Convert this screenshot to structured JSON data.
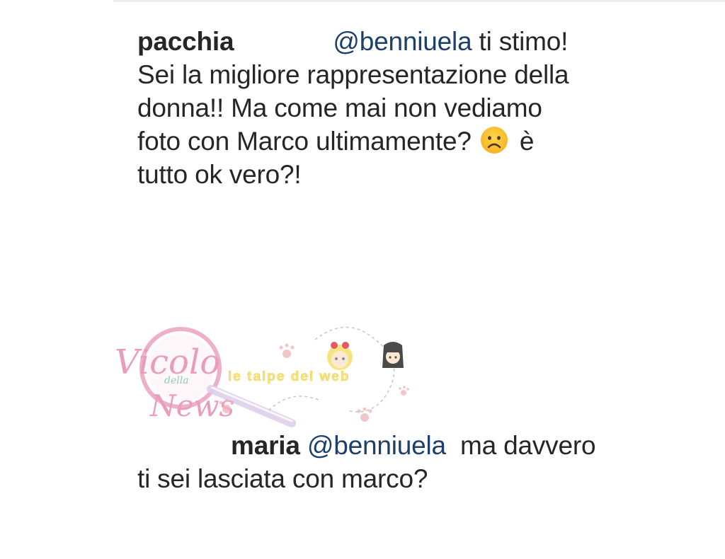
{
  "comments": [
    {
      "username": "pacchia",
      "mention": "@benniuela",
      "line1_after_mention": " ti stimo!",
      "line2": "Sei la migliore rappresentazione della",
      "line3": "donna!! Ma come mai non vediamo",
      "line4_before_emoji": "foto con Marco ultimamente? ",
      "emoji": "frowning-face",
      "line4_after_emoji": " è",
      "line5": "tutto ok vero?!"
    },
    {
      "username": "maria",
      "mention": "@benniuela",
      "line1_after_mention": "  ma davvero",
      "line2": "ti sei lasciata con marco?"
    }
  ],
  "watermark": {
    "title": "Vicolo",
    "middle": "della",
    "bottom": "News",
    "tagline": "le talpe del web"
  },
  "colors": {
    "text": "#262626",
    "mention": "#1c3f6b",
    "watermark_pink": "#e68bb0",
    "watermark_yellow": "#f5e06a"
  }
}
